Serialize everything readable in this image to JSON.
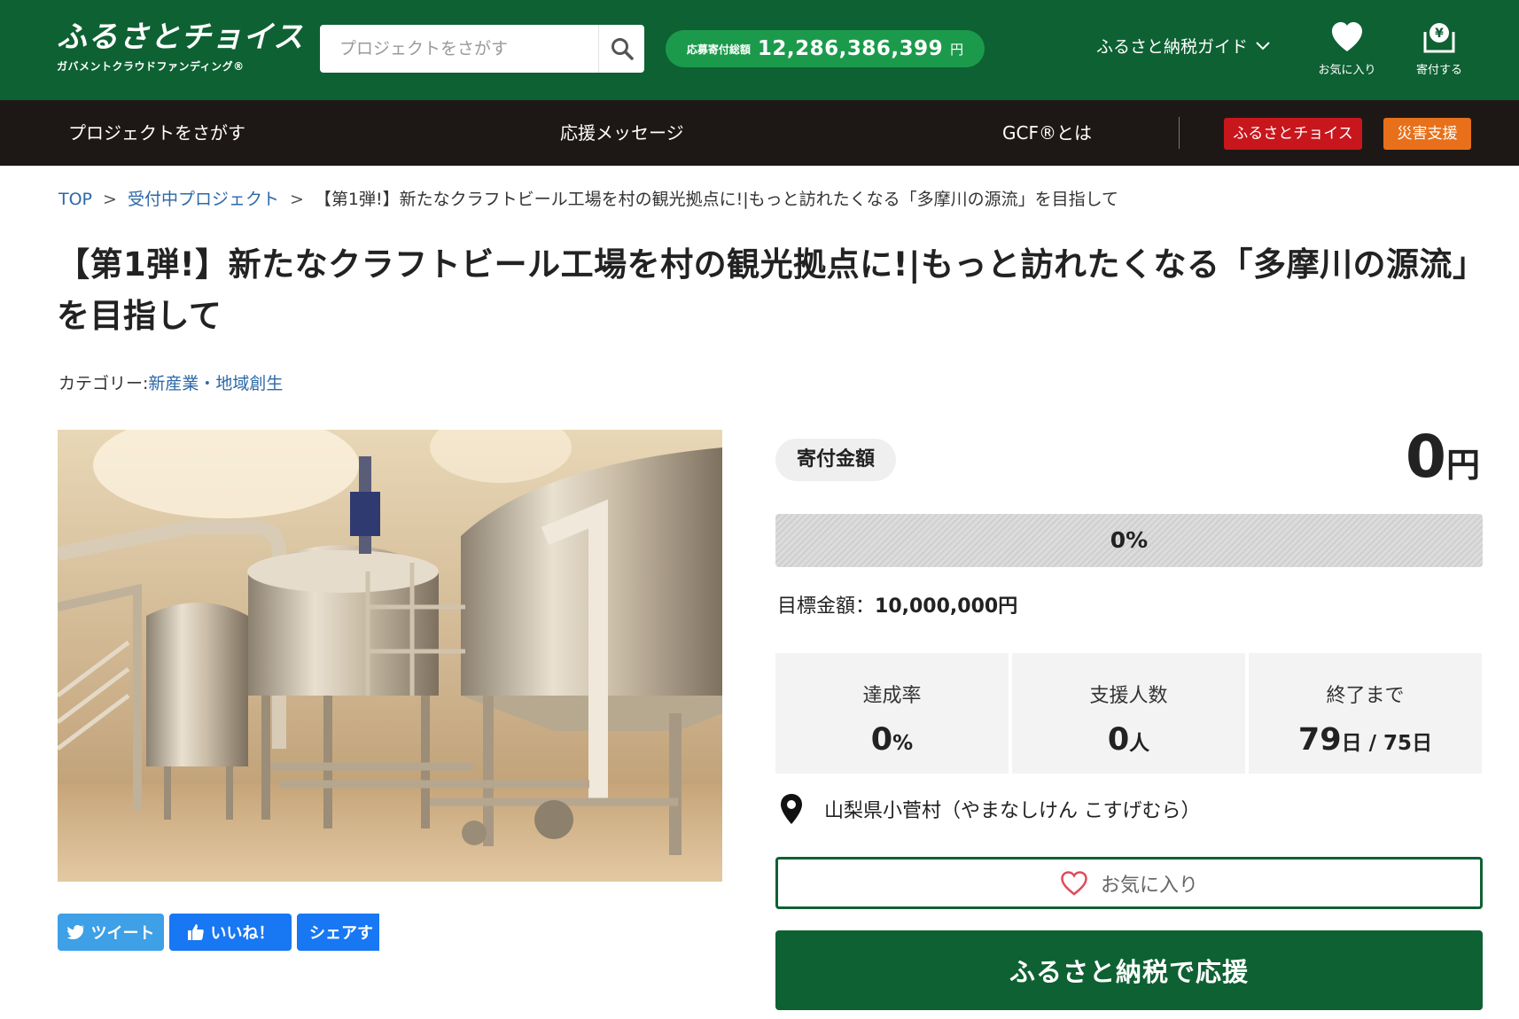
{
  "header": {
    "logo_main": "ふるさとチョイス",
    "logo_sub": "ガバメントクラウドファンディング®",
    "search_placeholder": "プロジェクトをさがす",
    "total_label": "応募寄付総額",
    "total_amount": "12,286,386,399",
    "total_unit": "円",
    "guide_label": "ふるさと納税ガイド",
    "favorite_label": "お気に入り",
    "donate_label": "寄付する"
  },
  "nav": {
    "find_projects": "プロジェクトをさがす",
    "messages": "応援メッセージ",
    "about_gcf": "GCF®とは",
    "furusato_choice": "ふるさとチョイス",
    "disaster_support": "災害支援"
  },
  "breadcrumb": {
    "top": "TOP",
    "sep": ">",
    "active_projects": "受付中プロジェクト",
    "current": "【第1弾!】新たなクラフトビール工場を村の観光拠点に!|もっと訪れたくなる「多摩川の源流」を目指して"
  },
  "project": {
    "title_line1": "【第1弾!】新たなクラフトビール工場を村の観光拠点に!|もっと訪れたくなる「多摩川の源流」",
    "title_line2": "を目指して",
    "category_label": "カテゴリー:",
    "category_value": "新産業・地域創生"
  },
  "share": {
    "tweet": "ツイート",
    "like": "いいね！",
    "share": "シェアす"
  },
  "panel": {
    "donation_label": "寄付金額",
    "donation_amount": "0",
    "donation_unit": "円",
    "progress_fraction": 0,
    "progress_text": "0%",
    "goal_label": "目標金額：",
    "goal_value": "10,000,000円",
    "stats": {
      "rate_label": "達成率",
      "rate_value": "0",
      "rate_unit": "%",
      "supporters_label": "支援人数",
      "supporters_value": "0",
      "supporters_unit": "人",
      "remaining_label": "終了まで",
      "remaining_value": "79",
      "remaining_unit": "日",
      "remaining_total": " / 75日"
    },
    "location": "山梨県小菅村（やまなしけん こすげむら）",
    "favorite_button": "お気に入り",
    "support_button": "ふるさと納税で応援"
  },
  "colors": {
    "brand_green": "#0e6133",
    "accent_green": "#1c9a4c",
    "nav_dark": "#1d1815",
    "badge_red": "#c8161d",
    "badge_orange": "#e8701a",
    "link_blue": "#2c68a8",
    "twitter_blue": "#3ea0e6",
    "facebook_blue": "#1877f2"
  }
}
